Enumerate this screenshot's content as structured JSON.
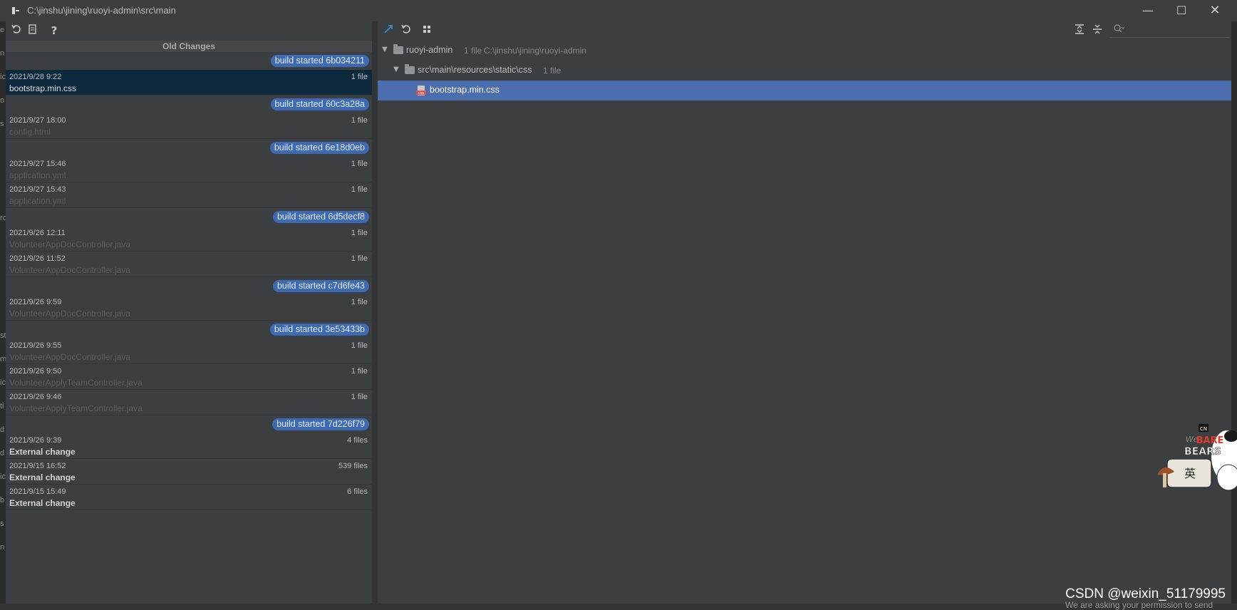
{
  "window": {
    "title": "C:\\jinshu\\jining\\ruoyi-admin\\src\\main",
    "minimize_glyph": "—",
    "maximize_glyph": "☐",
    "close_glyph": "✕"
  },
  "left_panel": {
    "header": "Old Changes",
    "toolbar_icons": [
      "revert-icon",
      "patch-icon",
      "help-icon"
    ],
    "rows": [
      {
        "kind": "build",
        "label": "build started 6b034211"
      },
      {
        "kind": "change",
        "date": "2021/9/28 9:22",
        "count": "1 file",
        "file": "bootstrap.min.css",
        "selected": true
      },
      {
        "kind": "build",
        "label": "build started 60c3a28a"
      },
      {
        "kind": "change",
        "date": "2021/9/27 18:00",
        "count": "1 file",
        "file": "config.html"
      },
      {
        "kind": "build",
        "label": "build started 6e18d0eb"
      },
      {
        "kind": "change",
        "date": "2021/9/27 15:46",
        "count": "1 file",
        "file": "application.yml"
      },
      {
        "kind": "change",
        "date": "2021/9/27 15:43",
        "count": "1 file",
        "file": "application.yml"
      },
      {
        "kind": "build",
        "label": "build started 6d5decf8"
      },
      {
        "kind": "change",
        "date": "2021/9/26 12:11",
        "count": "1 file",
        "file": "VolunteerAppDocController.java"
      },
      {
        "kind": "change",
        "date": "2021/9/26 11:52",
        "count": "1 file",
        "file": "VolunteerAppDocController.java"
      },
      {
        "kind": "build",
        "label": "build started c7d6fe43"
      },
      {
        "kind": "change",
        "date": "2021/9/26 9:59",
        "count": "1 file",
        "file": "VolunteerAppDocController.java"
      },
      {
        "kind": "build",
        "label": "build started 3e53433b"
      },
      {
        "kind": "change",
        "date": "2021/9/26 9:55",
        "count": "1 file",
        "file": "VolunteerAppDocController.java"
      },
      {
        "kind": "change",
        "date": "2021/9/26 9:50",
        "count": "1 file",
        "file": "VolunteerApplyTeamController.java"
      },
      {
        "kind": "change",
        "date": "2021/9/26 9:46",
        "count": "1 file",
        "file": "VolunteerApplyTeamController.java"
      },
      {
        "kind": "build",
        "label": "build started 7d226f79"
      },
      {
        "kind": "change",
        "date": "2021/9/26 9:39",
        "count": "4 files",
        "file": "External change",
        "bold": true
      },
      {
        "kind": "change",
        "date": "2021/9/15 16:52",
        "count": "539 files",
        "file": "External change",
        "bold": true
      },
      {
        "kind": "change",
        "date": "2021/9/15 15:49",
        "count": "6 files",
        "file": "External change",
        "bold": true
      }
    ]
  },
  "right_panel": {
    "toolbar_icons": [
      "show-diff-icon",
      "revert-icon",
      "group-by-icon",
      "expand-all-icon",
      "collapse-all-icon"
    ],
    "search": {
      "placeholder": ""
    },
    "tree": {
      "root": {
        "label": "ruoyi-admin",
        "count": "1 file",
        "path": "C:\\jinshu\\jining\\ruoyi-admin"
      },
      "folder": {
        "label": "src\\main\\resources\\static\\css",
        "count": "1 file"
      },
      "file": {
        "label": "bootstrap.min.css"
      }
    }
  },
  "background": {
    "left_strip_chars": [
      "e",
      "n",
      "ic",
      "o",
      "s",
      "",
      "",
      "",
      "ro",
      "",
      "",
      "",
      "",
      "st",
      "m",
      "ic",
      "ti",
      "d",
      "d",
      "ic",
      "b",
      "s",
      "n"
    ],
    "bottom_note": "We are asking your permission to send",
    "watermark": "CSDN @weixin_51179995"
  },
  "sticker": {
    "line1": "We",
    "line2": "BARE",
    "line3": "BEARS",
    "glyph": "英",
    "badge": "CN"
  },
  "colors": {
    "accent": "#4b6eaf",
    "badge": "#3d6ab3",
    "selected_row": "#0d293e",
    "panel_bg": "#3c3f41"
  }
}
